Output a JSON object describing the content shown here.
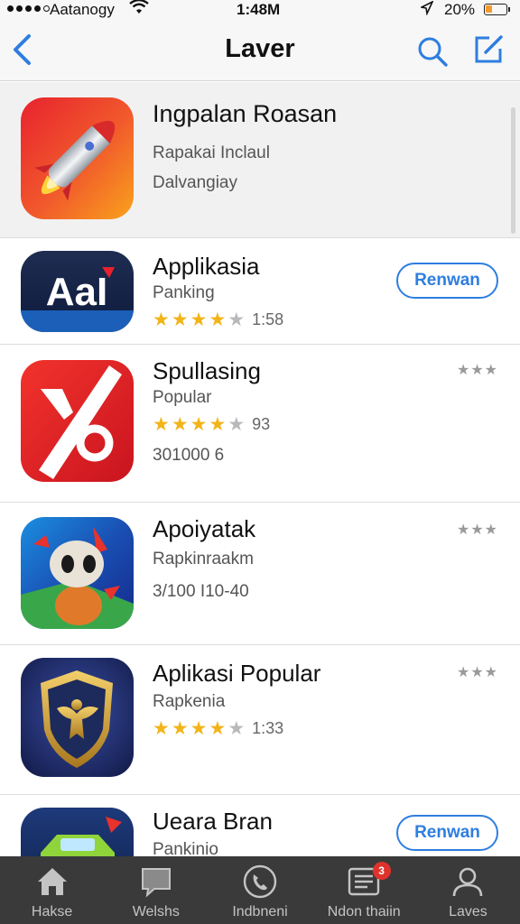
{
  "status_bar": {
    "carrier": "Aatanogy",
    "time": "1:48M",
    "battery": "20%",
    "wifi_icon": "wifi-icon",
    "location_icon": "location-arrow-icon"
  },
  "nav": {
    "title": "Laver",
    "back_icon": "chevron-left-icon",
    "search_icon": "search-icon",
    "compose_icon": "compose-icon"
  },
  "apps": [
    {
      "name": "Ingpalan Roasan",
      "subtitle": "Rapakai Inclaul",
      "subtitle2": "Dalvangiay",
      "icon": "rocket-icon"
    },
    {
      "name": "Applikasia",
      "subtitle": "Panking",
      "stars": "★★★",
      "stars_half": "★",
      "stars_off": "★",
      "rating_count": "1:58",
      "button": "Renwan",
      "icon": "aai-logo-icon"
    },
    {
      "name": "Spullasing",
      "subtitle": "Popular",
      "stars": "★★★",
      "stars_half": "★",
      "stars_off": "★",
      "rating_count": "93",
      "subtitle2": "301000 6",
      "mini_stars": "★★★",
      "icon": "slash-logo-icon"
    },
    {
      "name": "Apoiyatak",
      "subtitle": "Rapkinraakm",
      "subtitle2": "3/100 I10-40",
      "mini_stars": "★★★",
      "icon": "creature-icon"
    },
    {
      "name": "Aplikasi Popular",
      "subtitle": "Rapkenia",
      "stars": "★★★",
      "stars_half": "★",
      "stars_off": "★",
      "rating_count": "1:33",
      "mini_stars": "★★★",
      "icon": "eagle-shield-icon"
    },
    {
      "name": "Ueara Bran",
      "subtitle": "Pankinio",
      "button": "Renwan",
      "icon": "car-icon"
    }
  ],
  "tabs": [
    {
      "label": "Hakse",
      "icon": "home-icon"
    },
    {
      "label": "Welshs",
      "icon": "chat-bubble-icon"
    },
    {
      "label": "Indbneni",
      "icon": "phone-icon"
    },
    {
      "label": "Ndon thaiin",
      "icon": "list-icon",
      "badge": "3"
    },
    {
      "label": "Laves",
      "icon": "person-icon"
    }
  ],
  "colors": {
    "accent": "#2e7ee0",
    "star": "#f2b418",
    "tab_bar": "#3a3a3a",
    "badge": "#e0322c"
  }
}
